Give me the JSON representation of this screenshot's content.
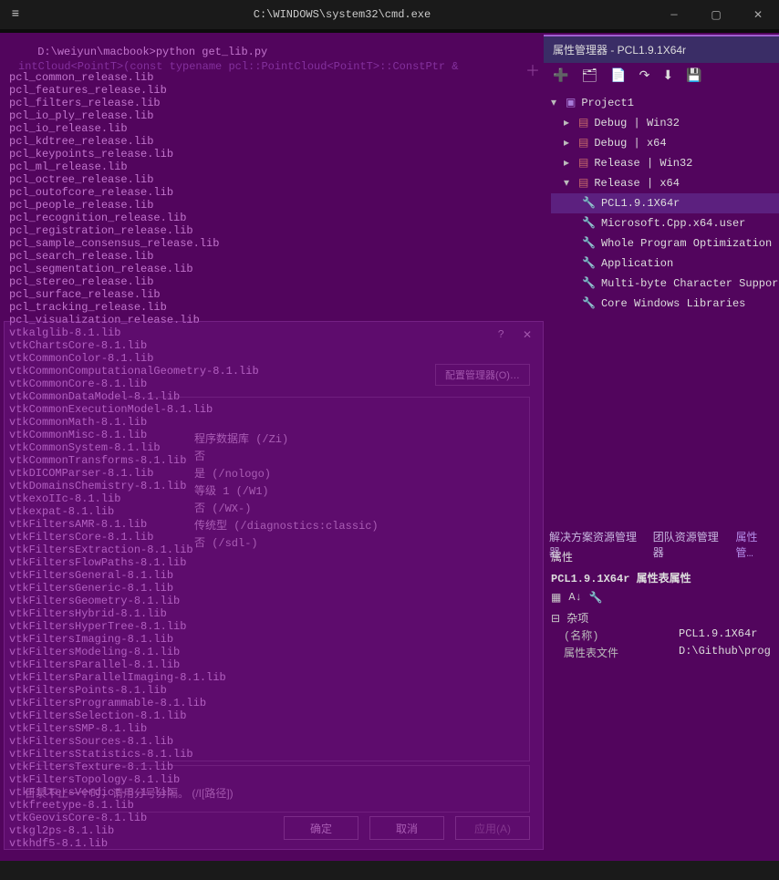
{
  "cmd": {
    "title": "C:\\WINDOWS\\system32\\cmd.exe",
    "prompt": "D:\\weiyun\\macbook>python get_lib.py",
    "code_hint": "intCloud<PointT>(const typename pcl::PointCloud<PointT>::ConstPtr &",
    "libs": [
      "pcl_common_release.lib",
      "pcl_features_release.lib",
      "pcl_filters_release.lib",
      "pcl_io_ply_release.lib",
      "pcl_io_release.lib",
      "pcl_kdtree_release.lib",
      "pcl_keypoints_release.lib",
      "pcl_ml_release.lib",
      "pcl_octree_release.lib",
      "pcl_outofcore_release.lib",
      "pcl_people_release.lib",
      "pcl_recognition_release.lib",
      "pcl_registration_release.lib",
      "pcl_sample_consensus_release.lib",
      "pcl_search_release.lib",
      "pcl_segmentation_release.lib",
      "pcl_stereo_release.lib",
      "pcl_surface_release.lib",
      "pcl_tracking_release.lib",
      "pcl_visualization_release.lib",
      "vtkalglib-8.1.lib",
      "vtkChartsCore-8.1.lib",
      "vtkCommonColor-8.1.lib",
      "vtkCommonComputationalGeometry-8.1.lib",
      "vtkCommonCore-8.1.lib",
      "vtkCommonDataModel-8.1.lib",
      "vtkCommonExecutionModel-8.1.lib",
      "vtkCommonMath-8.1.lib",
      "vtkCommonMisc-8.1.lib",
      "vtkCommonSystem-8.1.lib",
      "vtkCommonTransforms-8.1.lib",
      "vtkDICOMParser-8.1.lib",
      "vtkDomainsChemistry-8.1.lib",
      "vtkexoIIc-8.1.lib",
      "vtkexpat-8.1.lib",
      "vtkFiltersAMR-8.1.lib",
      "vtkFiltersCore-8.1.lib",
      "vtkFiltersExtraction-8.1.lib",
      "vtkFiltersFlowPaths-8.1.lib",
      "vtkFiltersGeneral-8.1.lib",
      "vtkFiltersGeneric-8.1.lib",
      "vtkFiltersGeometry-8.1.lib",
      "vtkFiltersHybrid-8.1.lib",
      "vtkFiltersHyperTree-8.1.lib",
      "vtkFiltersImaging-8.1.lib",
      "vtkFiltersModeling-8.1.lib",
      "vtkFiltersParallel-8.1.lib",
      "vtkFiltersParallelImaging-8.1.lib",
      "vtkFiltersPoints-8.1.lib",
      "vtkFiltersProgrammable-8.1.lib",
      "vtkFiltersSelection-8.1.lib",
      "vtkFiltersSMP-8.1.lib",
      "vtkFiltersSources-8.1.lib",
      "vtkFiltersStatistics-8.1.lib",
      "vtkFiltersTexture-8.1.lib",
      "vtkFiltersTopology-8.1.lib",
      "vtkFiltersVerdict-8.1.lib",
      "vtkfreetype-8.1.lib",
      "vtkGeovisCore-8.1.lib",
      "vtkgl2ps-8.1.lib",
      "vtkhdf5-8.1.lib"
    ]
  },
  "winbtns": {
    "min": "—",
    "max": "▢",
    "close": "✕"
  },
  "gutter_plus": "＋",
  "pm": {
    "title": "属性管理器 - PCL1.9.1X64r",
    "toolbar_icons": [
      "➕",
      "🗂",
      "📄",
      "↷",
      "⬇",
      "💾"
    ],
    "tree": {
      "project": "Project1",
      "configs": [
        {
          "label": "Debug | Win32",
          "expanded": false
        },
        {
          "label": "Debug | x64",
          "expanded": false
        },
        {
          "label": "Release | Win32",
          "expanded": false
        },
        {
          "label": "Release | x64",
          "expanded": true,
          "children": [
            "PCL1.9.1X64r",
            "Microsoft.Cpp.x64.user",
            "Whole Program Optimization",
            "Application",
            "Multi-byte Character Support",
            "Core Windows Libraries"
          ]
        }
      ]
    }
  },
  "tabs": {
    "a": "解决方案资源管理器",
    "b": "团队资源管理器",
    "c": "属性管…"
  },
  "props": {
    "header": "属性",
    "object": "PCL1.9.1X64r 属性表属性",
    "cat": "杂项",
    "rows": [
      {
        "k": "(名称)",
        "v": "PCL1.9.1X64r"
      },
      {
        "k": "属性表文件",
        "v": "D:\\Github\\prog"
      }
    ]
  },
  "dialog": {
    "cfg_btn": "配置管理器(O)…",
    "options": [
      "程序数据库 (/Zi)",
      "否",
      "",
      "",
      "是 (/nologo)",
      "等级 1 (/W1)",
      "否 (/WX-)",
      "",
      "传统型 (/diagnostics:classic)",
      "否 (/sdl-)"
    ],
    "hint": "目录不止一个时，请用分号分隔。      (/I[路径])",
    "ok": "确定",
    "cancel": "取消",
    "apply": "应用(A)"
  }
}
